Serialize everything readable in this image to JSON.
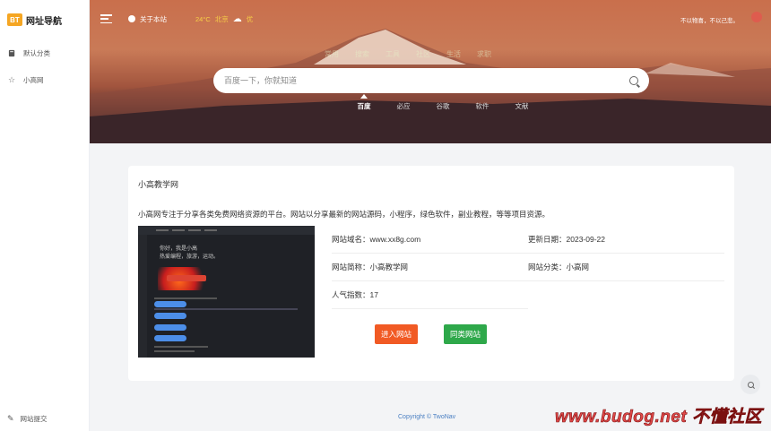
{
  "sidebar": {
    "logo_badge": "BT",
    "logo_text": "网址导航",
    "items": [
      {
        "label": "默认分类",
        "icon": "book-icon"
      },
      {
        "label": "小高网",
        "icon": "star-icon"
      }
    ],
    "bottom_item": {
      "label": "网站提交",
      "icon": "pencil-icon"
    }
  },
  "topbar": {
    "about_label": "关于本站",
    "temperature": "24°C",
    "city": "北京",
    "air_quality": "优",
    "slogan": "不以物喜，不以己悲。"
  },
  "categories": [
    "常用",
    "搜索",
    "工具",
    "社区",
    "生活",
    "求职"
  ],
  "search": {
    "placeholder": "百度一下，你就知道",
    "engines": [
      "百度",
      "必应",
      "谷歌",
      "软件",
      "文献"
    ],
    "active_engine": "百度"
  },
  "site": {
    "title": "小高教学网",
    "description": "小高网专注于分享各类免费网络资源的平台。网站以分享最新的网站源码，小程序，绿色软件，副业教程，等等项目资源。",
    "domain_label": "网站域名：",
    "domain": "www.xx8g.com",
    "update_label": "更新日期：",
    "update_date": "2023-09-22",
    "short_name_label": "网站简称：",
    "short_name": "小高教学网",
    "category_label": "网站分类：",
    "category": "小高网",
    "popularity_label": "人气指数：",
    "popularity": "17",
    "enter_button": "进入网站",
    "similar_button": "同类网站",
    "thumb_text_1": "你好，我是小高",
    "thumb_text_2": "热爱编程，旅游，运动。"
  },
  "footer": {
    "copyright": "Copyright © TwoNav"
  },
  "watermark": "www.budog.net 不懂社区",
  "colors": {
    "accent_orange": "#f15a24",
    "accent_green": "#2ea84a",
    "logo_badge": "#f5a623"
  }
}
